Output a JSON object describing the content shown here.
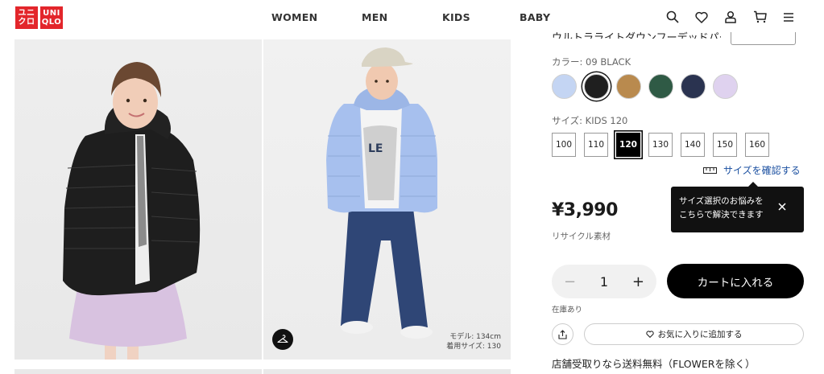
{
  "header": {
    "logo": {
      "line1": "ユニ",
      "line2": "クロ",
      "line3": "UNI",
      "line4": "QLO"
    },
    "nav": [
      "WOMEN",
      "MEN",
      "KIDS",
      "BABY"
    ],
    "icons": [
      "search-icon",
      "heart-icon",
      "user-icon",
      "cart-icon",
      "menu-icon"
    ]
  },
  "gallery": {
    "model_info_1": "モデル: 134cm",
    "model_info_2": "着用サイズ: 130"
  },
  "product": {
    "title_cut": "ウルトラライトダウンフーデッドパーカ",
    "color_label": "カラー: 09 BLACK",
    "colors": [
      "#c4d5f3",
      "#1f1f1f",
      "#b98a4e",
      "#2f5a45",
      "#2a3350",
      "#dfd2ef"
    ],
    "selected_color_index": 1,
    "size_label": "サイズ: KIDS 120",
    "sizes": [
      "100",
      "110",
      "120",
      "130",
      "140",
      "150",
      "160"
    ],
    "selected_size": "120",
    "size_check": "サイズを確認する",
    "tooltip_line1": "サイズ選択のお悩みを",
    "tooltip_line2": "こちらで解決できます",
    "price": "¥3,990",
    "recycle": "リサイクル素材",
    "quantity": "1",
    "add_to_cart": "カートに入れる",
    "stock": "在庫あり",
    "favorite": "お気に入りに追加する",
    "pickup": "店舗受取りなら送料無料（FLOWERを除く）"
  }
}
